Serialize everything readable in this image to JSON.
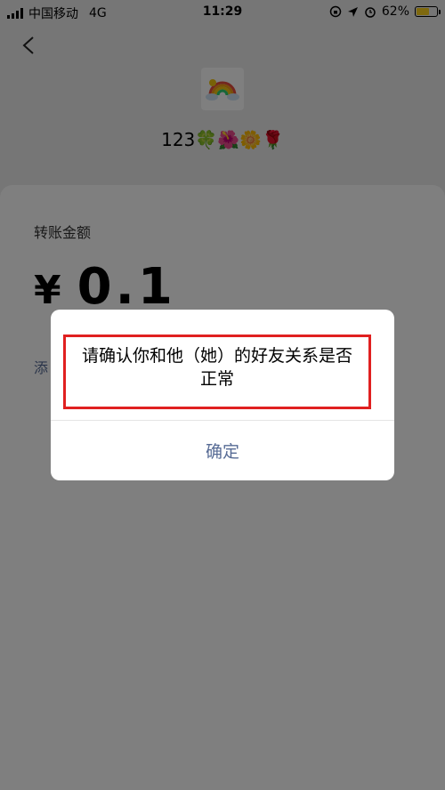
{
  "status_bar": {
    "carrier": "中国移动",
    "network": "4G",
    "time": "11:29",
    "battery_percent": "62%",
    "battery_level": 0.62
  },
  "header": {
    "payee_name": "123🍀🌺🌼🌹"
  },
  "transfer": {
    "title": "转账金额",
    "currency_symbol": "¥",
    "amount": "0.1",
    "remark_label": "添"
  },
  "dialog": {
    "message": "请确认你和他（她）的好友关系是否正常",
    "confirm_label": "确定"
  },
  "colors": {
    "link": "#576b95",
    "highlight_border": "#e02020",
    "battery": "#ffd21f"
  }
}
